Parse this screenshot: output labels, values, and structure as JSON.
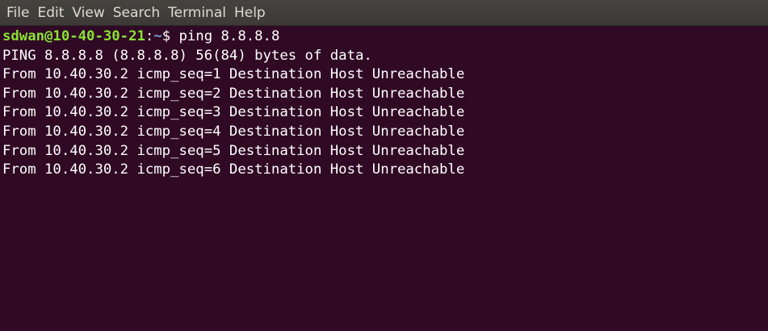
{
  "menubar": {
    "items": [
      "File",
      "Edit",
      "View",
      "Search",
      "Terminal",
      "Help"
    ]
  },
  "terminal": {
    "prompt": {
      "user_host": "sdwan@10-40-30-21",
      "separator": ":",
      "path": "~",
      "symbol": "$ ",
      "command": "ping 8.8.8.8"
    },
    "output": [
      "PING 8.8.8.8 (8.8.8.8) 56(84) bytes of data.",
      "From 10.40.30.2 icmp_seq=1 Destination Host Unreachable",
      "From 10.40.30.2 icmp_seq=2 Destination Host Unreachable",
      "From 10.40.30.2 icmp_seq=3 Destination Host Unreachable",
      "From 10.40.30.2 icmp_seq=4 Destination Host Unreachable",
      "From 10.40.30.2 icmp_seq=5 Destination Host Unreachable",
      "From 10.40.30.2 icmp_seq=6 Destination Host Unreachable"
    ]
  },
  "colors": {
    "background": "#300a24",
    "menubar": "#3c3b37",
    "prompt_user": "#8ae234",
    "prompt_path": "#729fcf",
    "text": "#ffffff"
  }
}
